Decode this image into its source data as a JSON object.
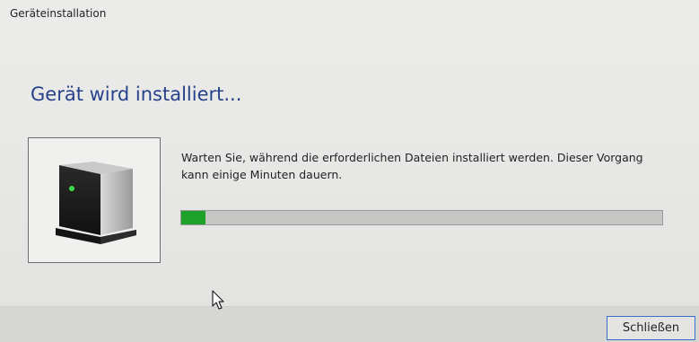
{
  "window": {
    "title": "Geräteinstallation"
  },
  "main": {
    "heading": "Gerät wird installiert...",
    "message": "Warten Sie, während die erforderlichen Dateien installiert werden. Dieser Vorgang kann einige Minuten dauern.",
    "device_icon": "device-icon",
    "progress_fraction": 0.05
  },
  "footer": {
    "close_label": "Schließen"
  },
  "colors": {
    "heading": "#27418a",
    "progress_fill": "#1ea12b",
    "progress_track": "#c6c7c5",
    "button_border": "#3a6fc9"
  }
}
